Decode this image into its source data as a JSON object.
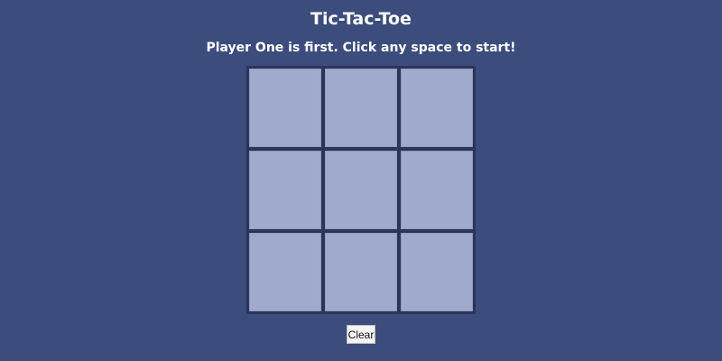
{
  "title": "Tic-Tac-Toe",
  "status": "Player One is first. Click any space to start!",
  "board": [
    "",
    "",
    "",
    "",
    "",
    "",
    "",
    "",
    ""
  ],
  "clear_label": "Clear",
  "colors": {
    "background": "#3c4c7c",
    "board": "#2b3559",
    "cell": "#a0aacc"
  }
}
